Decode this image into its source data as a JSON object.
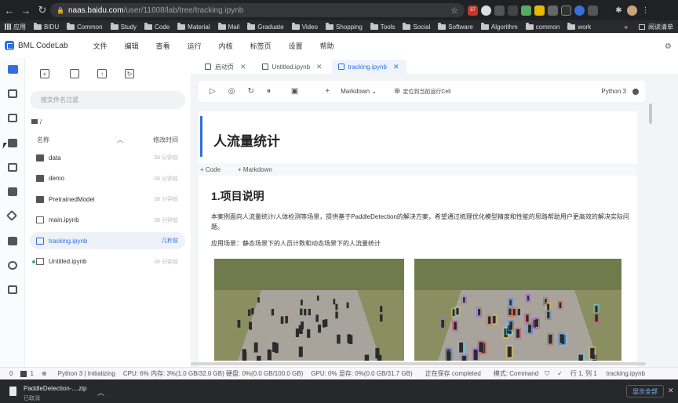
{
  "browser": {
    "url_host": "naas.baidu.com",
    "url_path": "/user/11608/lab/tree/tracking.ipynb",
    "ext_badge": "37"
  },
  "bookmarks": {
    "items": [
      "应用",
      "BIDU",
      "Common",
      "Study",
      "Code",
      "Material",
      "Mail",
      "Graduate",
      "Video",
      "Shopping",
      "Tools",
      "Social",
      "Software",
      "Algorithm",
      "common",
      "work"
    ],
    "more": "»",
    "reading_list": "阅读清单"
  },
  "app": {
    "title": "BML CodeLab",
    "menu": [
      "文件",
      "编辑",
      "查看",
      "运行",
      "内核",
      "标签页",
      "设置",
      "帮助"
    ]
  },
  "filepanel": {
    "filter_placeholder": "按文件名过滤",
    "breadcrumb": "/",
    "col_name": "名称",
    "col_time": "修改时间",
    "files": [
      {
        "name": "data",
        "time": "38 分钟前",
        "type": "folder"
      },
      {
        "name": "demo",
        "time": "38 分钟前",
        "type": "folder"
      },
      {
        "name": "PretrainedModel",
        "time": "38 分钟前",
        "type": "folder"
      },
      {
        "name": "main.ipynb",
        "time": "38 分钟前",
        "type": "notebook"
      },
      {
        "name": "tracking.ipynb",
        "time": "几秒前",
        "type": "notebook"
      },
      {
        "name": "Untitled.ipynb",
        "time": "38 分钟前",
        "type": "notebook"
      }
    ]
  },
  "tabs": [
    {
      "label": "启动页"
    },
    {
      "label": "Untitled.ipynb"
    },
    {
      "label": "tracking.ipynb"
    }
  ],
  "toolbar": {
    "cell_type": "Markdown",
    "locate": "定位到当前运行Cell",
    "kernel": "Python 3"
  },
  "notebook": {
    "title": "人流量统计",
    "add_code": "+ Code",
    "add_markdown": "+ Markdown",
    "section": "1.项目说明",
    "para1": "本案例面向人流量统计/人体检测等场景，提供基于PaddleDetection的解决方案，希望通过梳理优化模型精度和性能的思路帮助用户更高效的解决实际问题。",
    "para2": "应用场景：静态场景下的人员计数和动态场景下的人流量统计"
  },
  "status": {
    "a": "0",
    "b": "1",
    "kernel": "Python 3 | Initializing",
    "cpu": "CPU:  6% 内存: 3%(1.0 GB/32.0 GB) 硬盘: 0%(0.0 GB/100.0 GB)",
    "gpu": "GPU:  0%  显存: 0%(0.0 GB/31.7 GB)",
    "save": "正在保存 completed",
    "mode": "模式: Command",
    "pos": "行 1, 列 1",
    "file": "tracking.ipynb"
  },
  "download": {
    "filename": "PaddleDetection-....zip",
    "state": "已取消",
    "show_all": "显示全部"
  }
}
